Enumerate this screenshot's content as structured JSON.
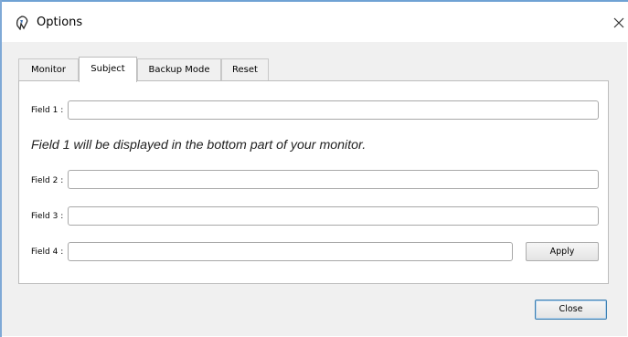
{
  "window": {
    "title": "Options"
  },
  "tabs": [
    {
      "label": "Monitor",
      "active": false
    },
    {
      "label": "Subject",
      "active": true
    },
    {
      "label": "Backup Mode",
      "active": false
    },
    {
      "label": "Reset",
      "active": false
    }
  ],
  "fields": {
    "field1": {
      "label": "Field 1 :",
      "value": ""
    },
    "field2": {
      "label": "Field 2 :",
      "value": ""
    },
    "field3": {
      "label": "Field 3 :",
      "value": ""
    },
    "field4": {
      "label": "Field 4 :",
      "value": ""
    }
  },
  "note": "Field 1 will be displayed in the bottom part of your monitor.",
  "buttons": {
    "apply": "Apply",
    "close": "Close"
  },
  "icons": {
    "app": "app-logo-icon",
    "window_close": "close-icon"
  },
  "colors": {
    "window_border": "#6fa2d4",
    "dialog_background": "#f0f0f0",
    "close_button_border": "#3c7fb1"
  }
}
